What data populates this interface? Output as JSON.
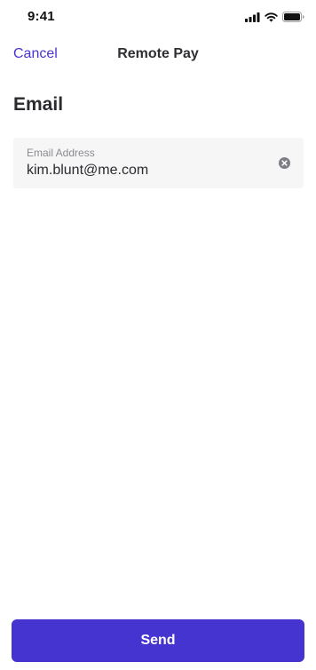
{
  "status_bar": {
    "time": "9:41",
    "icons": [
      "cellular-signal-icon",
      "wifi-icon",
      "battery-icon"
    ]
  },
  "nav": {
    "cancel_label": "Cancel",
    "title": "Remote Pay"
  },
  "section": {
    "heading": "Email"
  },
  "email_field": {
    "label": "Email Address",
    "value": "kim.blunt@me.com",
    "clear_icon": "clear-circle-icon"
  },
  "actions": {
    "send_label": "Send"
  },
  "colors": {
    "accent": "#4534cf",
    "link": "#4a34cc",
    "field_background": "#f6f6f7",
    "text": "#2b2b2f"
  }
}
